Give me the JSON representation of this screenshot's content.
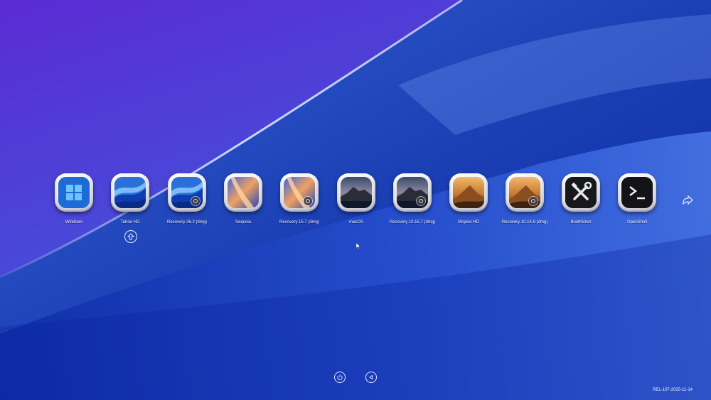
{
  "boot_entries": [
    {
      "label": "Windows",
      "icon": "windows-logo-icon"
    },
    {
      "label": "Tahoe HD",
      "icon": "tahoe-wallpaper-icon"
    },
    {
      "label": "Recovery 26.2 (dmg)",
      "icon": "tahoe-recovery-icon"
    },
    {
      "label": "Sequoia",
      "icon": "sequoia-wallpaper-icon"
    },
    {
      "label": "Recovery 15.7 (dmg)",
      "icon": "sequoia-recovery-icon"
    },
    {
      "label": "macOS",
      "icon": "catalina-wallpaper-icon"
    },
    {
      "label": "Recovery 10.15.7 (dmg)",
      "icon": "catalina-recovery-icon"
    },
    {
      "label": "Mojave HD",
      "icon": "mojave-wallpaper-icon"
    },
    {
      "label": "Recovery 10.14.6 (dmg)",
      "icon": "mojave-recovery-icon"
    },
    {
      "label": "BootKicker",
      "icon": "tools-icon"
    },
    {
      "label": "OpenShell",
      "icon": "terminal-icon"
    }
  ],
  "selected_index": 1,
  "controls": {
    "next_page_icon": "next-page-arrow-icon",
    "shutdown_icon": "power-icon",
    "restart_icon": "restart-icon"
  },
  "version": "REL-107-2025-11-14",
  "colors": {
    "background_top": "#5a2fd1",
    "background_bottom": "#0f2fb3",
    "label_text": "#f2f4ff",
    "frame": "#e6e8ee"
  }
}
